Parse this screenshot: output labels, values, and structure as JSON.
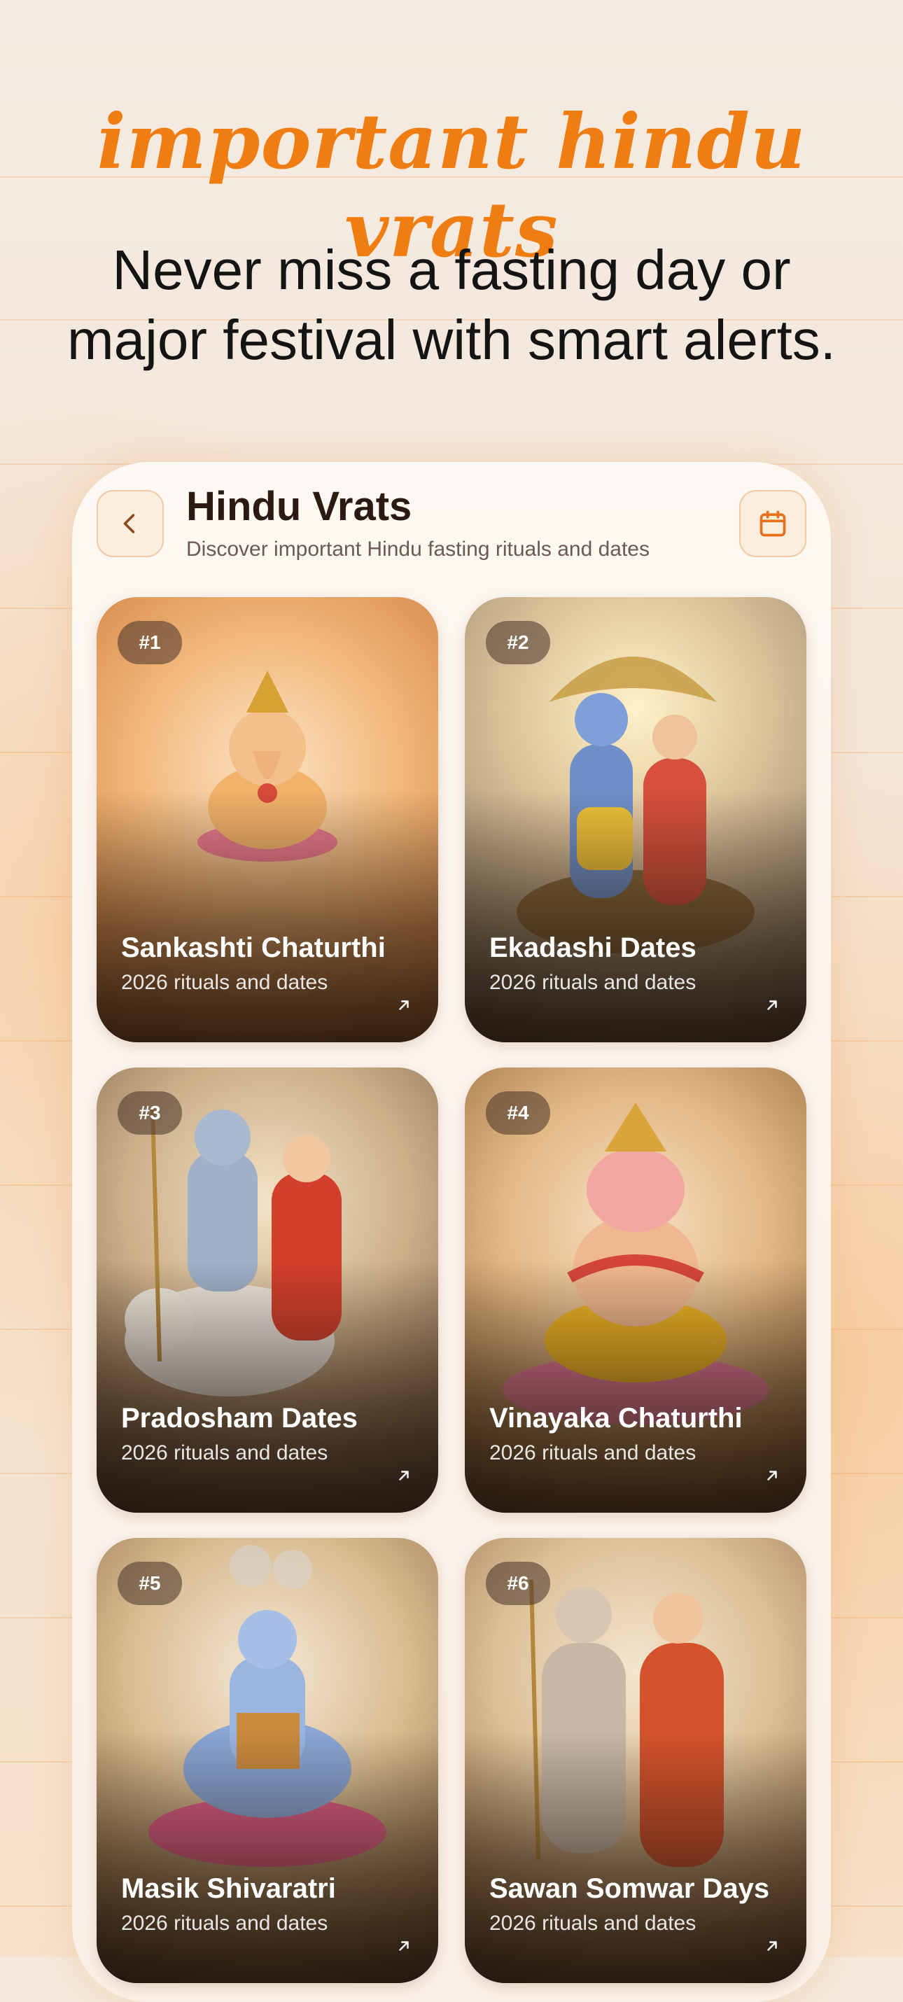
{
  "headline": "important hindu vrats",
  "subheadline_line1": "Never miss a fasting day or",
  "subheadline_line2": "major festival with smart alerts.",
  "app": {
    "title": "Hindu Vrats",
    "subtitle": "Discover important Hindu fasting rituals and dates",
    "back_icon": "chevron-left-icon",
    "calendar_icon": "calendar-icon"
  },
  "colors": {
    "accent": "#f07d12",
    "background": "#f5e9dd",
    "card_text": "#ffffff"
  },
  "cards": [
    {
      "badge": "#1",
      "title": "Sankashti Chaturthi",
      "subtitle": "2026 rituals and dates",
      "icon": "arrow-up-right-icon"
    },
    {
      "badge": "#2",
      "title": "Ekadashi Dates",
      "subtitle": "2026 rituals and dates",
      "icon": "arrow-up-right-icon"
    },
    {
      "badge": "#3",
      "title": "Pradosham Dates",
      "subtitle": "2026 rituals and dates",
      "icon": "arrow-up-right-icon"
    },
    {
      "badge": "#4",
      "title": "Vinayaka Chaturthi",
      "subtitle": "2026 rituals and dates",
      "icon": "arrow-up-right-icon"
    },
    {
      "badge": "#5",
      "title": "Masik Shivaratri",
      "subtitle": "2026 rituals and dates",
      "icon": "arrow-up-right-icon"
    },
    {
      "badge": "#6",
      "title": "Sawan Somwar Days",
      "subtitle": "2026 rituals and dates",
      "icon": "arrow-up-right-icon"
    }
  ]
}
